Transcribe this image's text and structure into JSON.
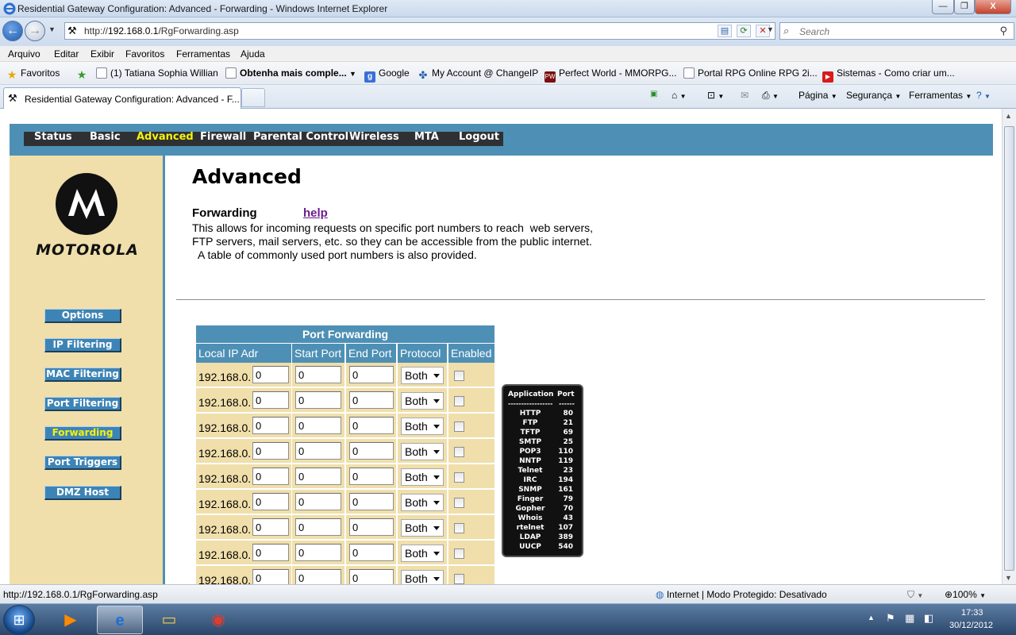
{
  "window": {
    "title": "Residential Gateway Configuration: Advanced - Forwarding - Windows Internet Explorer",
    "min_label": "—",
    "max_label": "❐",
    "close_label": "X"
  },
  "address": {
    "url_prefix": "http://",
    "url_host": "192.168.0.1",
    "url_path": "/RgForwarding.asp",
    "search_placeholder": "Search"
  },
  "menu": [
    "Arquivo",
    "Editar",
    "Exibir",
    "Favoritos",
    "Ferramentas",
    "Ajuda"
  ],
  "favorites": {
    "label": "Favoritos",
    "items": [
      {
        "label": "(1) Tatiana Sophia Willian",
        "bold": false
      },
      {
        "label": "Obtenha mais comple...",
        "bold": true
      },
      {
        "label": "Google",
        "bold": false
      },
      {
        "label": "My Account @ ChangeIP",
        "bold": false
      },
      {
        "label": "Perfect World - MMORPG...",
        "bold": false
      },
      {
        "label": "Portal RPG Online  RPG 2i...",
        "bold": false
      },
      {
        "label": "Sistemas - Como criar um...",
        "bold": false
      }
    ]
  },
  "tab": {
    "title": "Residential Gateway Configuration: Advanced - F..."
  },
  "commandbar": {
    "page": "Página",
    "security": "Segurança",
    "tools": "Ferramentas"
  },
  "router": {
    "nav": [
      {
        "label": "Status",
        "active": false
      },
      {
        "label": "Basic",
        "active": false
      },
      {
        "label": "Advanced",
        "active": true
      },
      {
        "label": "Firewall",
        "active": false
      },
      {
        "label": "Parental Control",
        "active": false
      },
      {
        "label": "Wireless",
        "active": false
      },
      {
        "label": "MTA",
        "active": false
      },
      {
        "label": "Logout",
        "active": false
      }
    ],
    "brand": "MOTOROLA",
    "side_menu": [
      {
        "label": "Options",
        "active": false
      },
      {
        "label": "IP Filtering",
        "active": false
      },
      {
        "label": "MAC Filtering",
        "active": false
      },
      {
        "label": "Port Filtering",
        "active": false
      },
      {
        "label": "Forwarding",
        "active": true
      },
      {
        "label": "Port Triggers",
        "active": false
      },
      {
        "label": "DMZ Host",
        "active": false
      }
    ],
    "page_title": "Advanced",
    "section_title": "Forwarding",
    "help_label": "help",
    "description": [
      "This allows for incoming requests on specific port numbers to reach  web servers,",
      "FTP servers, mail servers, etc. so they can be accessible from the public internet.",
      "  A table of commonly used port numbers is also provided."
    ],
    "table": {
      "caption": "Port Forwarding",
      "headers": [
        "Local IP Adr",
        "Start Port",
        "End Port",
        "Protocol",
        "Enabled"
      ],
      "ip_prefix": "192.168.0.",
      "rows": [
        {
          "ip": "0",
          "start": "0",
          "end": "0",
          "protocol": "Both",
          "enabled": false
        },
        {
          "ip": "0",
          "start": "0",
          "end": "0",
          "protocol": "Both",
          "enabled": false
        },
        {
          "ip": "0",
          "start": "0",
          "end": "0",
          "protocol": "Both",
          "enabled": false
        },
        {
          "ip": "0",
          "start": "0",
          "end": "0",
          "protocol": "Both",
          "enabled": false
        },
        {
          "ip": "0",
          "start": "0",
          "end": "0",
          "protocol": "Both",
          "enabled": false
        },
        {
          "ip": "0",
          "start": "0",
          "end": "0",
          "protocol": "Both",
          "enabled": false
        },
        {
          "ip": "0",
          "start": "0",
          "end": "0",
          "protocol": "Both",
          "enabled": false
        },
        {
          "ip": "0",
          "start": "0",
          "end": "0",
          "protocol": "Both",
          "enabled": false
        },
        {
          "ip": "0",
          "start": "0",
          "end": "0",
          "protocol": "Both",
          "enabled": false
        }
      ]
    },
    "port_reference": {
      "header_app": "Application",
      "header_port": "Port",
      "dash_app": "-----------------",
      "dash_port": "------",
      "entries": [
        {
          "app": "HTTP",
          "port": "80"
        },
        {
          "app": "FTP",
          "port": "21"
        },
        {
          "app": "TFTP",
          "port": "69"
        },
        {
          "app": "SMTP",
          "port": "25"
        },
        {
          "app": "POP3",
          "port": "110"
        },
        {
          "app": "NNTP",
          "port": "119"
        },
        {
          "app": "Telnet",
          "port": "23"
        },
        {
          "app": "IRC",
          "port": "194"
        },
        {
          "app": "SNMP",
          "port": "161"
        },
        {
          "app": "Finger",
          "port": "79"
        },
        {
          "app": "Gopher",
          "port": "70"
        },
        {
          "app": "Whois",
          "port": "43"
        },
        {
          "app": "rtelnet",
          "port": "107"
        },
        {
          "app": "LDAP",
          "port": "389"
        },
        {
          "app": "UUCP",
          "port": "540"
        }
      ]
    }
  },
  "statusbar": {
    "link": "http://192.168.0.1/RgForwarding.asp",
    "zone": "Internet | Modo Protegido: Desativado",
    "zoom": "100%"
  },
  "taskbar": {
    "time": "17:33",
    "date": "30/12/2012"
  },
  "colors": {
    "router_blue": "#4e90b5",
    "router_tan": "#f0dfab",
    "active_yellow": "#f5f20c",
    "help_purple": "#6d1c8c"
  }
}
